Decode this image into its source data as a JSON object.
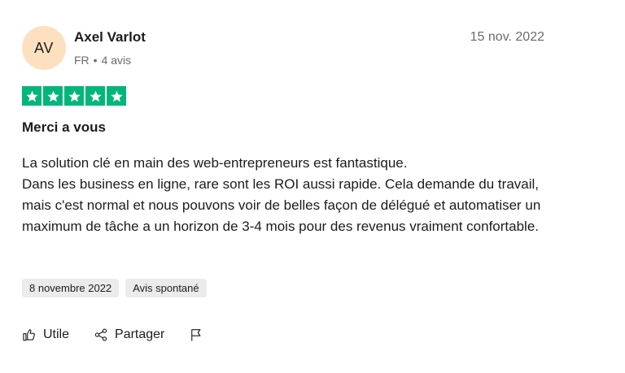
{
  "review": {
    "author": {
      "initials": "AV",
      "name": "Axel Varlot",
      "country": "FR",
      "separator": "•",
      "review_count": "4 avis"
    },
    "date": "15 nov. 2022",
    "rating": 5,
    "rating_max": 5,
    "star_color": "#00b67a",
    "title": "Merci a vous",
    "body": [
      "La solution clé en main des web-entrepreneurs est fantastique.",
      "Dans les business en ligne, rare sont les ROI aussi rapide. Cela demande du travail, mais c'est normal et nous pouvons voir de belles façon de délégué et automatiser un maximum de tâche a un horizon de 3-4 mois pour des revenus vraiment confortable."
    ],
    "tags": {
      "experience_date": "8 novembre 2022",
      "source": "Avis spontané"
    },
    "actions": {
      "useful_label": "Utile",
      "useful_icon": "thumbs-up-icon",
      "share_label": "Partager",
      "share_icon": "share-icon",
      "report_icon": "flag-icon"
    }
  }
}
